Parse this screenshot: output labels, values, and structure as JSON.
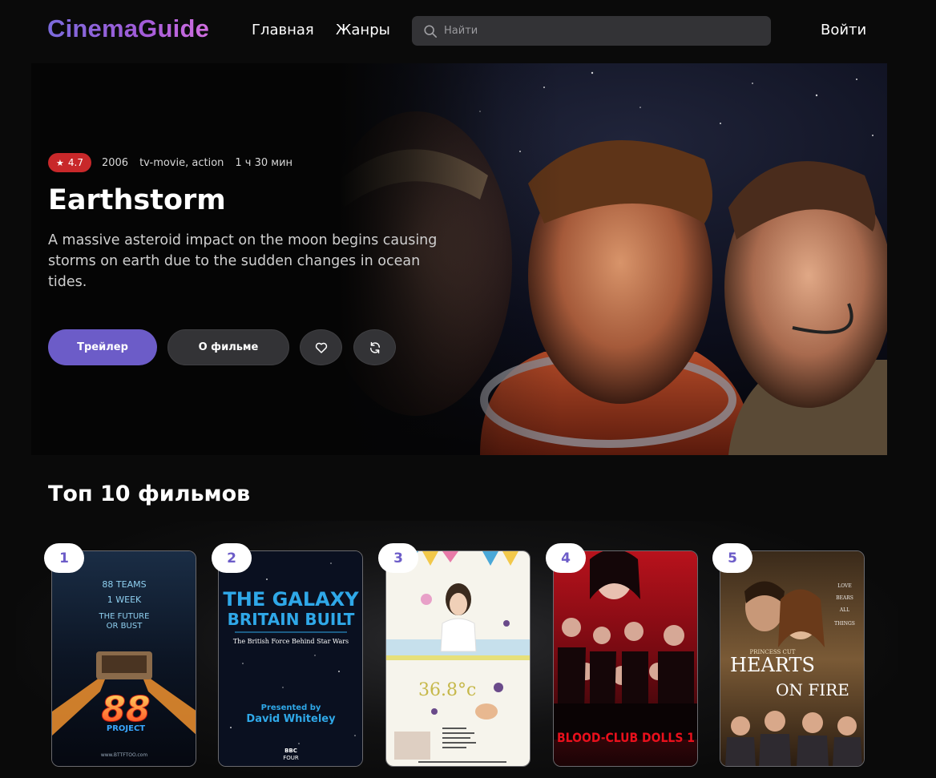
{
  "header": {
    "logo": "CinemaGuide",
    "nav": {
      "home": "Главная",
      "genres": "Жанры"
    },
    "search": {
      "placeholder": "Найти",
      "value": ""
    },
    "login": "Войти"
  },
  "hero": {
    "rating": "4.7",
    "year": "2006",
    "genres": "tv-movie, action",
    "duration": "1 ч 30 мин",
    "title": "Earthstorm",
    "description": "A massive asteroid impact on the moon begins causing storms on earth due to the sudden changes in ocean tides.",
    "buttons": {
      "trailer": "Трейлер",
      "about": "О фильме"
    },
    "icons": {
      "rating": "star-icon",
      "favorite": "heart-icon",
      "refresh": "refresh-icon"
    },
    "colors": {
      "accent": "#6c5cc8",
      "rating_badge": "#c8282a"
    }
  },
  "top": {
    "title": "Топ 10 фильмов",
    "movies": [
      {
        "rank": "1",
        "poster_lines": [
          "88 TEAMS",
          "1 WEEK",
          "THE FUTURE",
          "OR BUST"
        ],
        "poster_logo": "88",
        "poster_logo_sub": "PROJECT",
        "poster_url": "www.BTTFTOO.com"
      },
      {
        "rank": "2",
        "poster_title_1": "THE GALAXY",
        "poster_title_2": "BRITAIN BUILT",
        "poster_sub": "The British Force Behind Star Wars",
        "poster_presented": "Presented by",
        "poster_presenter": "David Whiteley",
        "poster_channel_1": "BBC",
        "poster_channel_2": "FOUR"
      },
      {
        "rank": "3",
        "poster_title": "36.8°c"
      },
      {
        "rank": "4",
        "poster_title": "BLOOD-CLUB DOLLS 1"
      },
      {
        "rank": "5",
        "poster_top": "PRINCESS CUT",
        "poster_title_1": "HEARTS",
        "poster_title_2": "ON FIRE",
        "poster_tagline": [
          "LOVE",
          "BEARS",
          "ALL",
          "THINGS"
        ]
      }
    ]
  }
}
